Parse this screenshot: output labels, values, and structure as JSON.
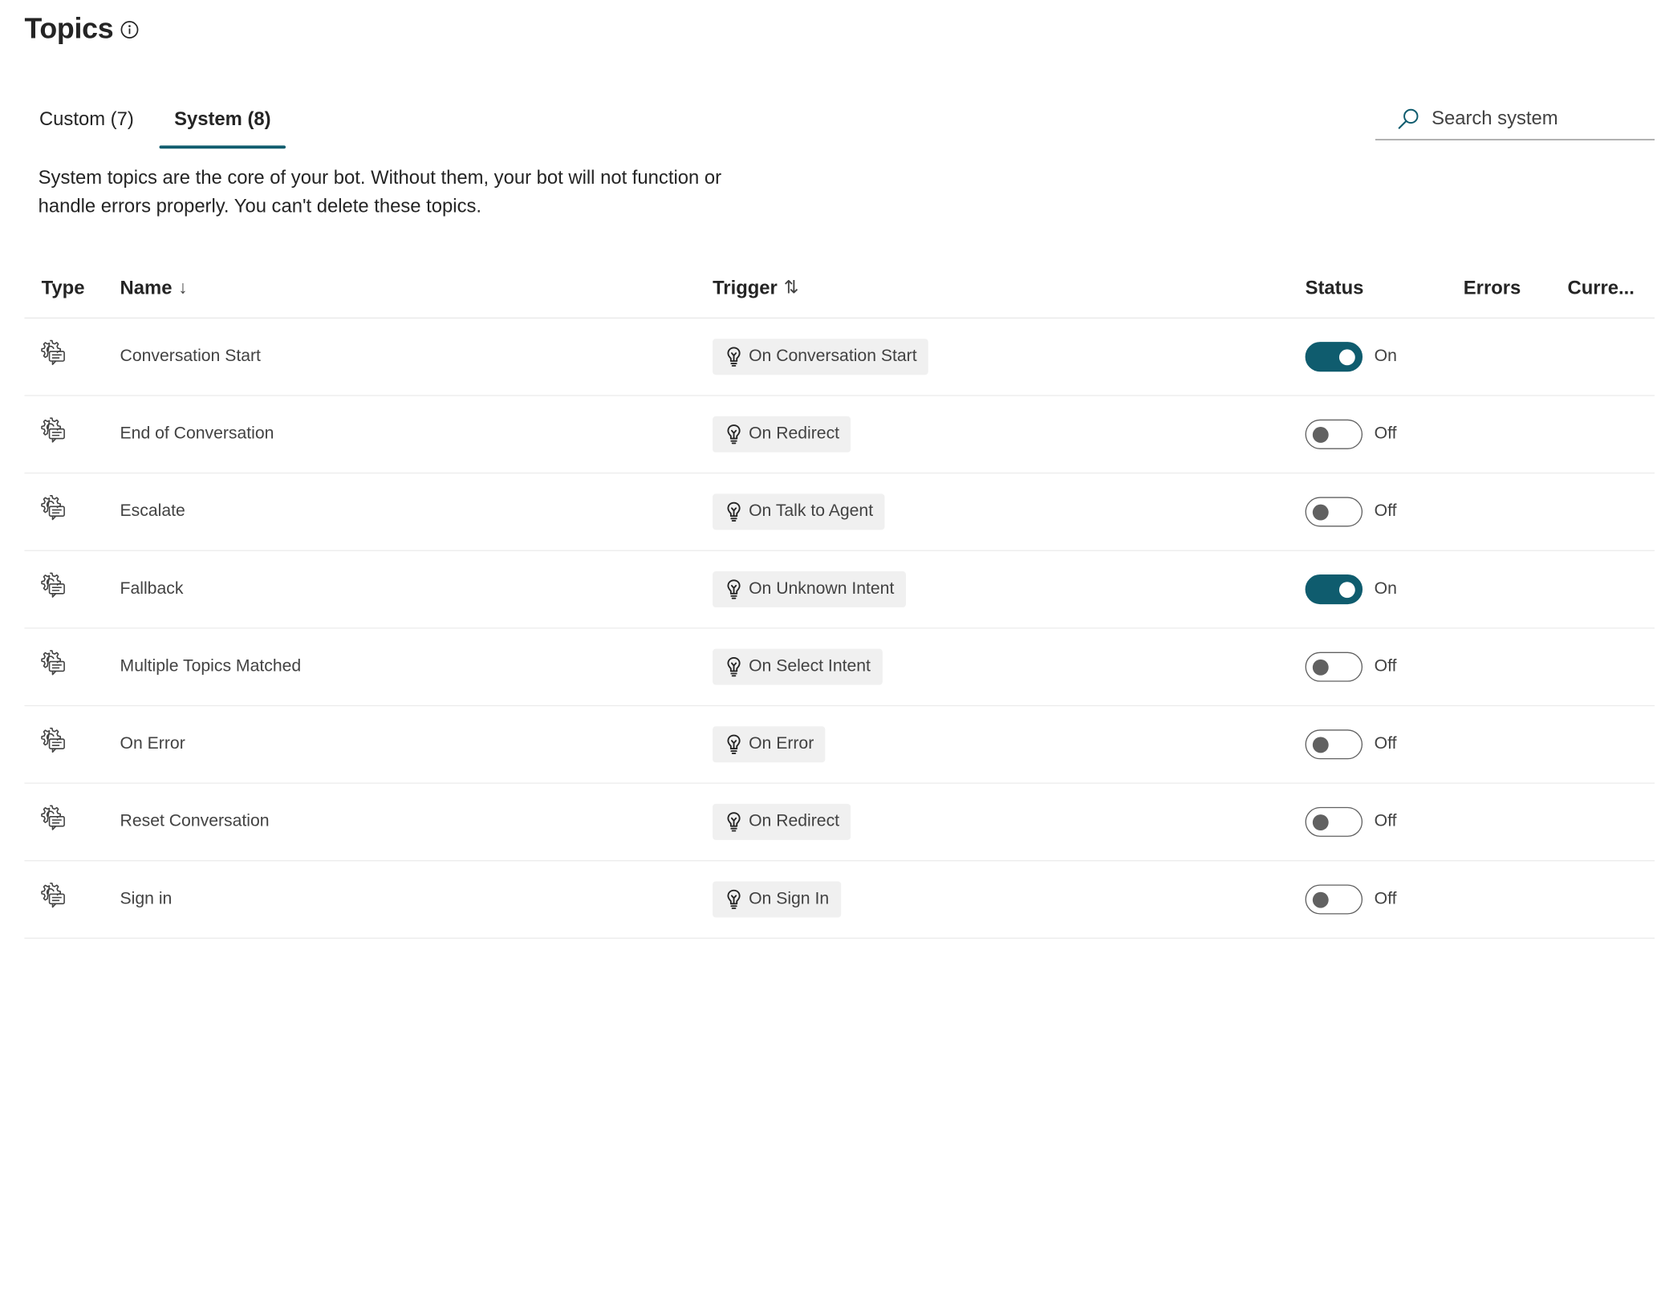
{
  "header": {
    "title": "Topics",
    "info_icon": "info-icon"
  },
  "tabs": [
    {
      "label": "Custom (7)",
      "active": false
    },
    {
      "label": "System (8)",
      "active": true
    }
  ],
  "search": {
    "placeholder": "Search system",
    "value": "",
    "icon": "search-icon"
  },
  "description": "System topics are the core of your bot. Without them, your bot will not function or handle errors properly. You can't delete these topics.",
  "table": {
    "columns": {
      "type": "Type",
      "name": "Name",
      "name_sort": "↓",
      "trigger": "Trigger",
      "trigger_sort": "⇅",
      "status": "Status",
      "errors": "Errors",
      "current": "Curre..."
    },
    "rows": [
      {
        "type_icon": "gear-chat-icon",
        "name": "Conversation Start",
        "trigger": "On Conversation Start",
        "status_on": true,
        "status": "On"
      },
      {
        "type_icon": "gear-chat-icon",
        "name": "End of Conversation",
        "trigger": "On Redirect",
        "status_on": false,
        "status": "Off"
      },
      {
        "type_icon": "gear-chat-icon",
        "name": "Escalate",
        "trigger": "On Talk to Agent",
        "status_on": false,
        "status": "Off"
      },
      {
        "type_icon": "gear-chat-icon",
        "name": "Fallback",
        "trigger": "On Unknown Intent",
        "status_on": true,
        "status": "On"
      },
      {
        "type_icon": "gear-chat-icon",
        "name": "Multiple Topics Matched",
        "trigger": "On Select Intent",
        "status_on": false,
        "status": "Off"
      },
      {
        "type_icon": "gear-chat-icon",
        "name": "On Error",
        "trigger": "On Error",
        "status_on": false,
        "status": "Off"
      },
      {
        "type_icon": "gear-chat-icon",
        "name": "Reset Conversation",
        "trigger": "On Redirect",
        "status_on": false,
        "status": "Off"
      },
      {
        "type_icon": "gear-chat-icon",
        "name": "Sign in",
        "trigger": "On Sign In",
        "status_on": false,
        "status": "Off"
      }
    ]
  },
  "colors": {
    "accent": "#0f5c6e",
    "chip_bg": "#f0f0f0",
    "toggle_off": "#616161"
  }
}
